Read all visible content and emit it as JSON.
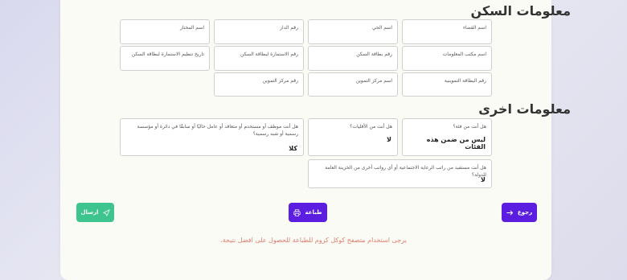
{
  "housing": {
    "title": "معلومات السكن",
    "fields": {
      "district": "اسم القضاء",
      "neighborhood": "اسم الحي",
      "house_no": "رقم الدار",
      "mukhtar": "اسم المختار",
      "info_office": "اسم مكتب المعلومات",
      "residence_card_no": "رقم بطاقة السكن",
      "residence_form_no": "رقم الاستمارة لبطاقة السكن",
      "residence_form_date": "تاريخ تنظيم الاستمارة لبطاقة السكن",
      "ration_card_no": "رقم البطاقة التموينية",
      "supply_center_name": "اسم مركز التموين",
      "supply_center_no": "رقم مركز التموين"
    }
  },
  "other": {
    "title": "معلومات اخرى",
    "q_group": {
      "label": "هل أنت من فئة؟",
      "value": "ليس من ضمن هذه الفئات"
    },
    "q_minority": {
      "label": "هل أنت من الأقليات؟",
      "value": "لا"
    },
    "q_employee": {
      "label": "هل أنت موظف أو مستخدم أو متعاقد أو عامل حاليًا أو سابقًا في دائرة أو مؤسسة رسمية أو شبه رسمية؟",
      "value": "كلا"
    },
    "q_welfare": {
      "label": "هل أنت مستفيد من راتب الرعاية الاجتماعية أو أي رواتب أخرى من الخزينة العامة للدولة؟",
      "value": "لا"
    }
  },
  "buttons": {
    "back": "رجوع",
    "print": "طباعة",
    "send": "ارسال"
  },
  "note": "يرجى استخدام متصفح كوكل كروم للطباعة للحصول على افضل نتيجة.",
  "colors": {
    "primary": "#5b1de0",
    "success": "#3ec58f",
    "note": "#e07c6e"
  },
  "icons": {
    "back": "arrow-right-icon",
    "print": "printer-icon",
    "send": "send-icon"
  }
}
